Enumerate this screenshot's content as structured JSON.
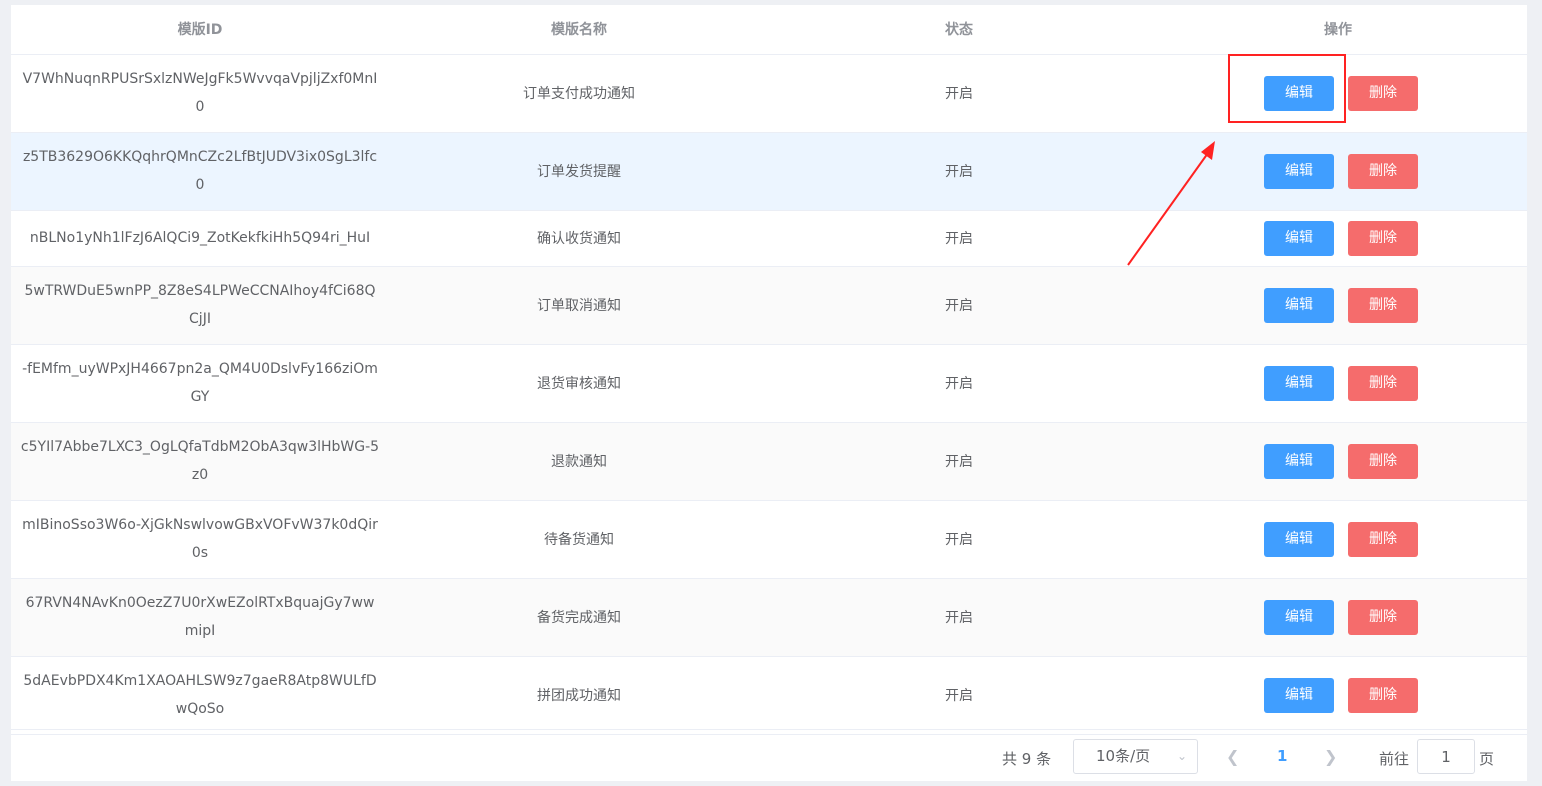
{
  "table": {
    "headers": {
      "id": "模版ID",
      "name": "模版名称",
      "status": "状态",
      "actions": "操作"
    },
    "edit_label": "编辑",
    "delete_label": "删除",
    "rows": [
      {
        "id": "V7WhNuqnRPUSrSxlzNWeJgFk5WvvqaVpjljZxf0MnI0",
        "name": "订单支付成功通知",
        "status": "开启"
      },
      {
        "id": "z5TB3629O6KKQqhrQMnCZc2LfBtJUDV3ix0SgL3lfc0",
        "name": "订单发货提醒",
        "status": "开启"
      },
      {
        "id": "nBLNo1yNh1lFzJ6AlQCi9_ZotKekfkiHh5Q94ri_HuI",
        "name": "确认收货通知",
        "status": "开启"
      },
      {
        "id": "5wTRWDuE5wnPP_8Z8eS4LPWeCCNAIhoy4fCi68QCjJI",
        "name": "订单取消通知",
        "status": "开启"
      },
      {
        "id": "-fEMfm_uyWPxJH4667pn2a_QM4U0DslvFy166ziOmGY",
        "name": "退货审核通知",
        "status": "开启"
      },
      {
        "id": "c5YIl7Abbe7LXC3_OgLQfaTdbM2ObA3qw3lHbWG-5z0",
        "name": "退款通知",
        "status": "开启"
      },
      {
        "id": "mIBinoSso3W6o-XjGkNswlvowGBxVOFvW37k0dQir0s",
        "name": "待备货通知",
        "status": "开启"
      },
      {
        "id": "67RVN4NAvKn0OezZ7U0rXwEZolRTxBquajGy7wwmipI",
        "name": "备货完成通知",
        "status": "开启"
      },
      {
        "id": "5dAEvbPDX4Km1XAOAHLSW9z7gaeR8Atp8WULfDwQoSo",
        "name": "拼团成功通知",
        "status": "开启"
      }
    ]
  },
  "pagination": {
    "total_text": "共 9 条",
    "page_size": "10条/页",
    "current_page": "1",
    "goto_label": "前往",
    "goto_value": "1",
    "page_suffix": "页",
    "prev_icon": "chevron-left-icon",
    "next_icon": "chevron-right-icon"
  },
  "colors": {
    "edit": "#409eff",
    "delete": "#f56c6c",
    "highlight": "#ff2222"
  }
}
